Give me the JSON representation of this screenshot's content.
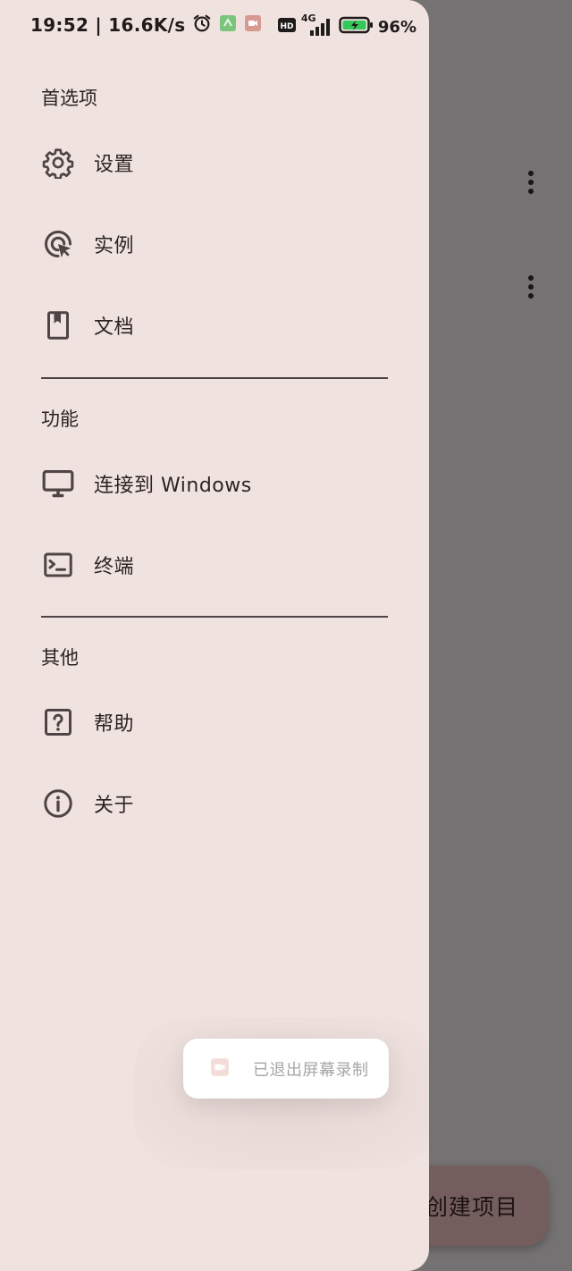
{
  "status_bar": {
    "time_speed": "19:52 | 16.6K/s",
    "network": "4G",
    "battery": "96%",
    "icons": [
      "alarm-icon",
      "app-notification-icon",
      "screen-record-icon",
      "hd-icon",
      "signal-icon",
      "battery-charging-icon"
    ]
  },
  "drawer": {
    "sections": [
      {
        "title": "首选项",
        "items": [
          {
            "label": "设置",
            "icon": "gear-icon"
          },
          {
            "label": "实例",
            "icon": "cursor-click-icon"
          },
          {
            "label": "文档",
            "icon": "book-bookmark-icon"
          }
        ]
      },
      {
        "title": "功能",
        "items": [
          {
            "label": "连接到 Windows",
            "icon": "monitor-icon"
          },
          {
            "label": "终端",
            "icon": "terminal-icon"
          }
        ]
      },
      {
        "title": "其他",
        "items": [
          {
            "label": "帮助",
            "icon": "help-icon"
          },
          {
            "label": "关于",
            "icon": "info-icon"
          }
        ]
      }
    ]
  },
  "fab": {
    "label": "创建项目"
  },
  "toast": {
    "text": "已退出屏幕录制",
    "icon": "screen-record-icon"
  },
  "colors": {
    "drawer_bg": "#f0e2df",
    "scrim": "#747273",
    "fab_bg": "#735e5d",
    "icon": "#4f4445"
  }
}
